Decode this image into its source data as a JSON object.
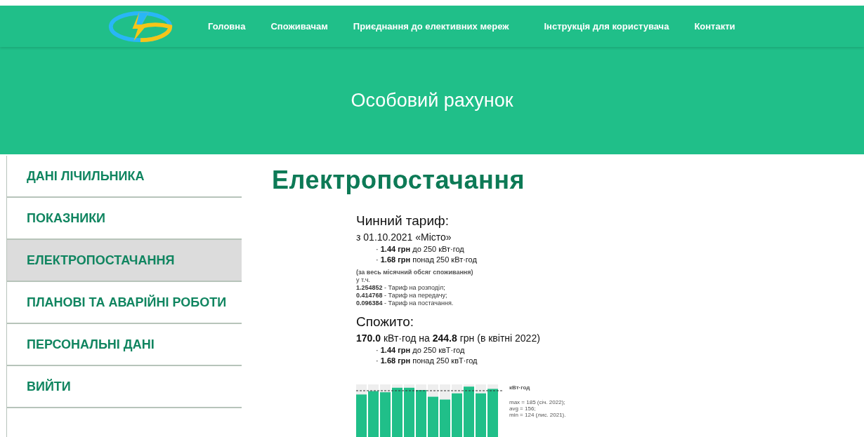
{
  "nav": {
    "items": [
      {
        "label": "Головна"
      },
      {
        "label": "Споживачам"
      },
      {
        "label": "Приєднання до елективних мереж"
      },
      {
        "label": "Інструкція для користувача"
      },
      {
        "label": "Контакти"
      }
    ]
  },
  "hero": {
    "title": "Особовий рахунок"
  },
  "sidebar": {
    "items": [
      {
        "label": "ДАНІ ЛІЧИЛЬНИКА",
        "selected": false
      },
      {
        "label": "ПОКАЗНИКИ",
        "selected": false
      },
      {
        "label": "ЕЛЕКТРОПОСТАЧАННЯ",
        "selected": true
      },
      {
        "label": "ПЛАНОВІ ТА АВАРІЙНІ РОБОТИ",
        "selected": false
      },
      {
        "label": "ПЕРСОНАЛЬНІ ДАНІ",
        "selected": false
      },
      {
        "label": "ВИЙТИ",
        "selected": false
      }
    ]
  },
  "main": {
    "heading": "Електропостачання",
    "tariff": {
      "title": "Чинний тариф:",
      "subtitle": "з 01.10.2021 «Місто»",
      "rates": [
        "· **1.44 грн** до 250 кВт·год",
        "· **1.68 грн** понад 250 кВт·год"
      ],
      "note": "(за весь місячний обсяг споживання)",
      "including": "у т.ч.",
      "components": [
        "**1.254852** - Тариф на розподіл;",
        "**0.414768** - Тариф на передачу;",
        "**0.096384** - Тариф на постачання."
      ]
    },
    "consumed": {
      "title": "Спожито:",
      "summary": "**170.0** кВт·год на **244.8** грн (в квітні 2022)",
      "rates": [
        "· **1.44 грн** до 250 квТ·год",
        "· **1.68 грн** понад 250 квТ·год"
      ],
      "chart": {
        "unit": "кВт·год",
        "stats": [
          "max = 185 (січ. 2022);",
          "avg = 156;",
          "min = 124 (лис. 2021)."
        ]
      }
    }
  }
}
